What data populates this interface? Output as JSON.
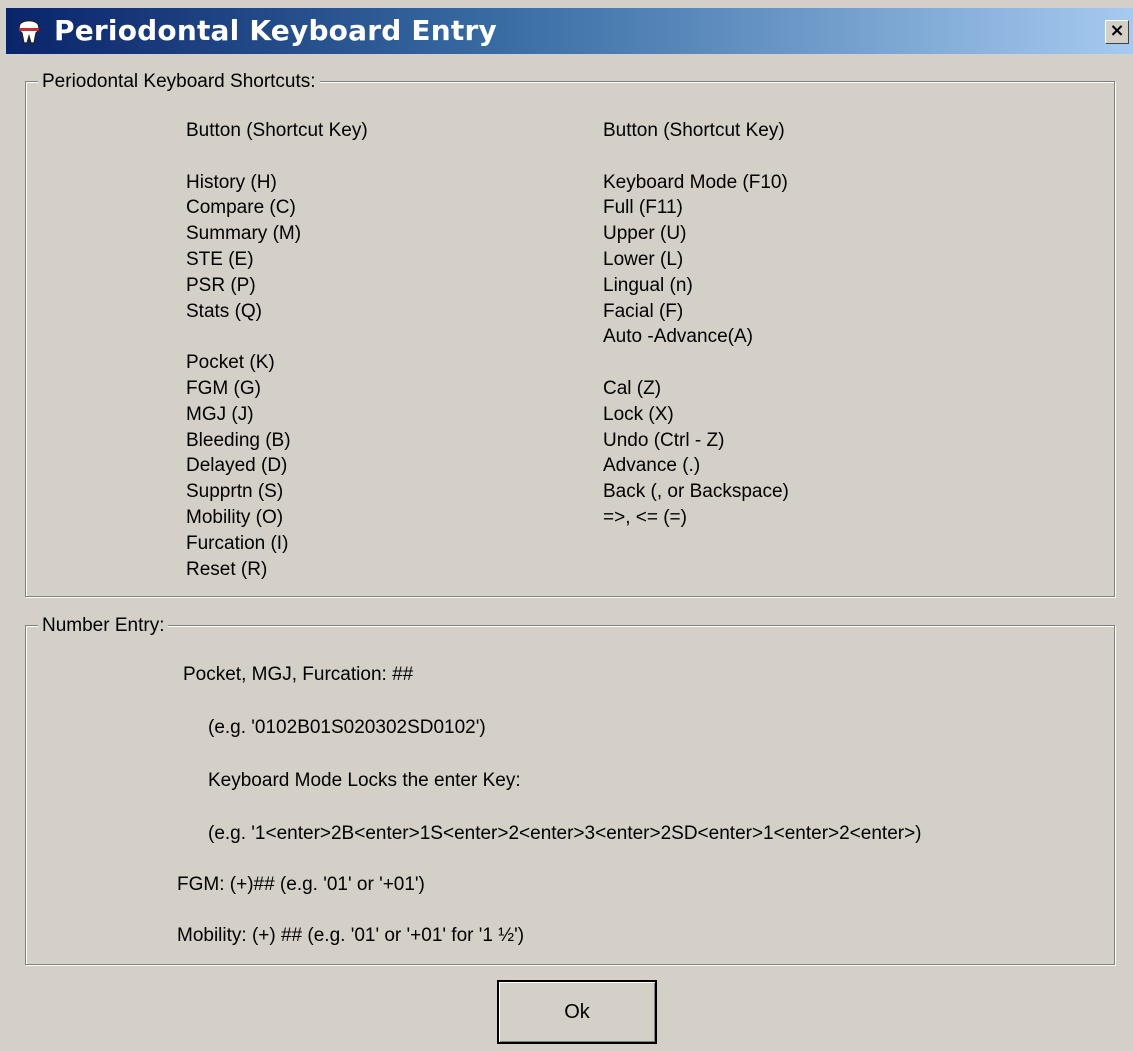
{
  "window": {
    "title": "Periodontal Keyboard Entry",
    "close_label": "×"
  },
  "shortcuts": {
    "legend": "Periodontal Keyboard Shortcuts:",
    "left_header": "Button (Shortcut Key)",
    "right_header": "Button (Shortcut Key)",
    "left_items": [
      "",
      "History (H)",
      "Compare (C)",
      "Summary (M)",
      "STE (E)",
      "PSR (P)",
      "Stats (Q)",
      "",
      "Pocket (K)",
      "FGM (G)",
      "MGJ (J)",
      "Bleeding (B)",
      "Delayed (D)",
      "Supprtn (S)",
      "Mobility (O)",
      "Furcation (I)",
      "Reset (R)"
    ],
    "right_items": [
      "",
      "Keyboard Mode (F10)",
      "Full (F11)",
      "Upper (U)",
      "Lower (L)",
      "Lingual (n)",
      "Facial (F)",
      "Auto -Advance(A)",
      "",
      "Cal (Z)",
      "Lock (X)",
      "Undo (Ctrl - Z)",
      "Advance (.)",
      "Back (, or Backspace)",
      "=>, <= (=)"
    ]
  },
  "number_entry": {
    "legend": "Number Entry:",
    "line1": "Pocket, MGJ, Furcation: ##",
    "line2": "(e.g. '0102B01S020302SD0102')",
    "line3": "Keyboard Mode Locks the enter Key:",
    "line4": "(e.g. '1<enter>2B<enter>1S<enter>2<enter>3<enter>2SD<enter>1<enter>2<enter>)",
    "line5": "FGM: (+)## (e.g. '01' or '+01')",
    "line6": "Mobility: (+) ## (e.g. '01' or '+01' for '1 ½')"
  },
  "ok_label": "Ok"
}
